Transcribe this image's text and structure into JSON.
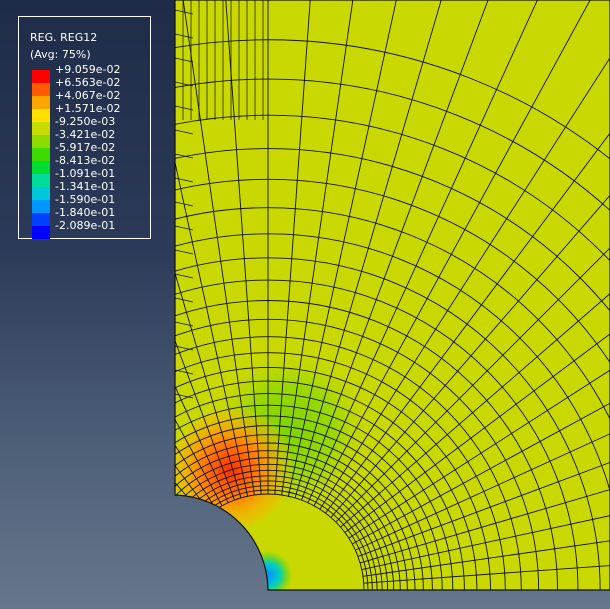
{
  "legend": {
    "title": "REG. REG12",
    "subtitle": "(Avg: 75%)",
    "labels": [
      "+9.059e-02",
      "+6.563e-02",
      "+4.067e-02",
      "+1.571e-02",
      "-9.250e-03",
      "-3.421e-02",
      "-5.917e-02",
      "-8.413e-02",
      "-1.091e-01",
      "-1.341e-01",
      "-1.590e-01",
      "-1.840e-01",
      "-2.089e-01"
    ],
    "colors": [
      "#ff0000",
      "#ff5a00",
      "#ffa500",
      "#ffe000",
      "#c8dc00",
      "#8cdc00",
      "#3cdc00",
      "#00dc30",
      "#00dc9a",
      "#00c8dc",
      "#0096ff",
      "#0040ff",
      "#0000ff"
    ]
  },
  "colors": {
    "mesh_fill": "#c8d800",
    "mesh_line": "#111111"
  }
}
